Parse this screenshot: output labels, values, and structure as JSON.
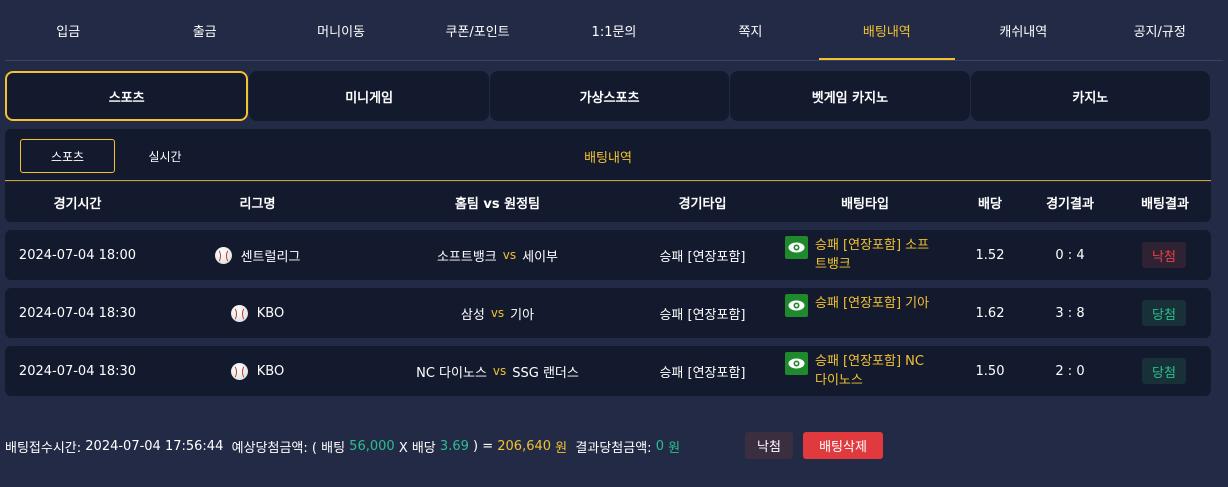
{
  "nav": {
    "items": [
      "입금",
      "출금",
      "머니이동",
      "쿠폰/포인트",
      "1:1문의",
      "쪽지",
      "배팅내역",
      "캐쉬내역",
      "공지/규정"
    ],
    "active_index": 6
  },
  "categories": [
    "스포츠",
    "미니게임",
    "가상스포츠",
    "벳게임 카지노",
    "카지노"
  ],
  "subbar": {
    "tabs": [
      "스포츠",
      "실시간"
    ],
    "title": "배팅내역"
  },
  "table": {
    "headers": [
      "경기시간",
      "리그명",
      "홈팀 vs 원정팀",
      "경기타입",
      "배팅타입",
      "배당",
      "경기결과",
      "배팅결과"
    ],
    "vs_label": "vs",
    "rows": [
      {
        "time": "2024-07-04 18:00",
        "league": "센트럴리그",
        "home": "소프트뱅크",
        "away": "세이부",
        "game_type": "승패 [연장포함]",
        "bet_type": "승패 [연장포함] 소프트뱅크",
        "odds": "1.52",
        "score": "0 : 4",
        "result": "낙첨"
      },
      {
        "time": "2024-07-04 18:30",
        "league": "KBO",
        "home": "삼성",
        "away": "기아",
        "game_type": "승패 [연장포함]",
        "bet_type": "승패 [연장포함] 기아",
        "odds": "1.62",
        "score": "3 : 8",
        "result": "당첨"
      },
      {
        "time": "2024-07-04 18:30",
        "league": "KBO",
        "home": "NC 다이노스",
        "away": "SSG 랜더스",
        "game_type": "승패 [연장포함]",
        "bet_type": "승패 [연장포함] NC 다이노스",
        "odds": "1.50",
        "score": "2 : 0",
        "result": "당첨"
      }
    ]
  },
  "footer": {
    "accept_label": "배팅접수시간:",
    "accept_time": "2024-07-04 17:56:44",
    "expected_label": "예상당첨금액:",
    "open_bet": "( 배팅",
    "bet_amount": "56,000",
    "times_odds": "X 배당",
    "total_odds": "3.69",
    "close_eq": ") =",
    "expected_amount": "206,640",
    "won": "원",
    "result_label": "결과당첨금액:",
    "result_amount": "0",
    "result_won": "원",
    "status_button": "낙첨",
    "delete_button": "배팅삭제"
  },
  "colors": {
    "accent": "#f2c230",
    "background": "#232a45",
    "panel": "#141a2e",
    "win": "#2bbf8e",
    "lose": "#e8414b",
    "delete": "#e03a3e"
  },
  "icons": {
    "league": "baseball-icon",
    "bet_view": "eye-icon"
  }
}
